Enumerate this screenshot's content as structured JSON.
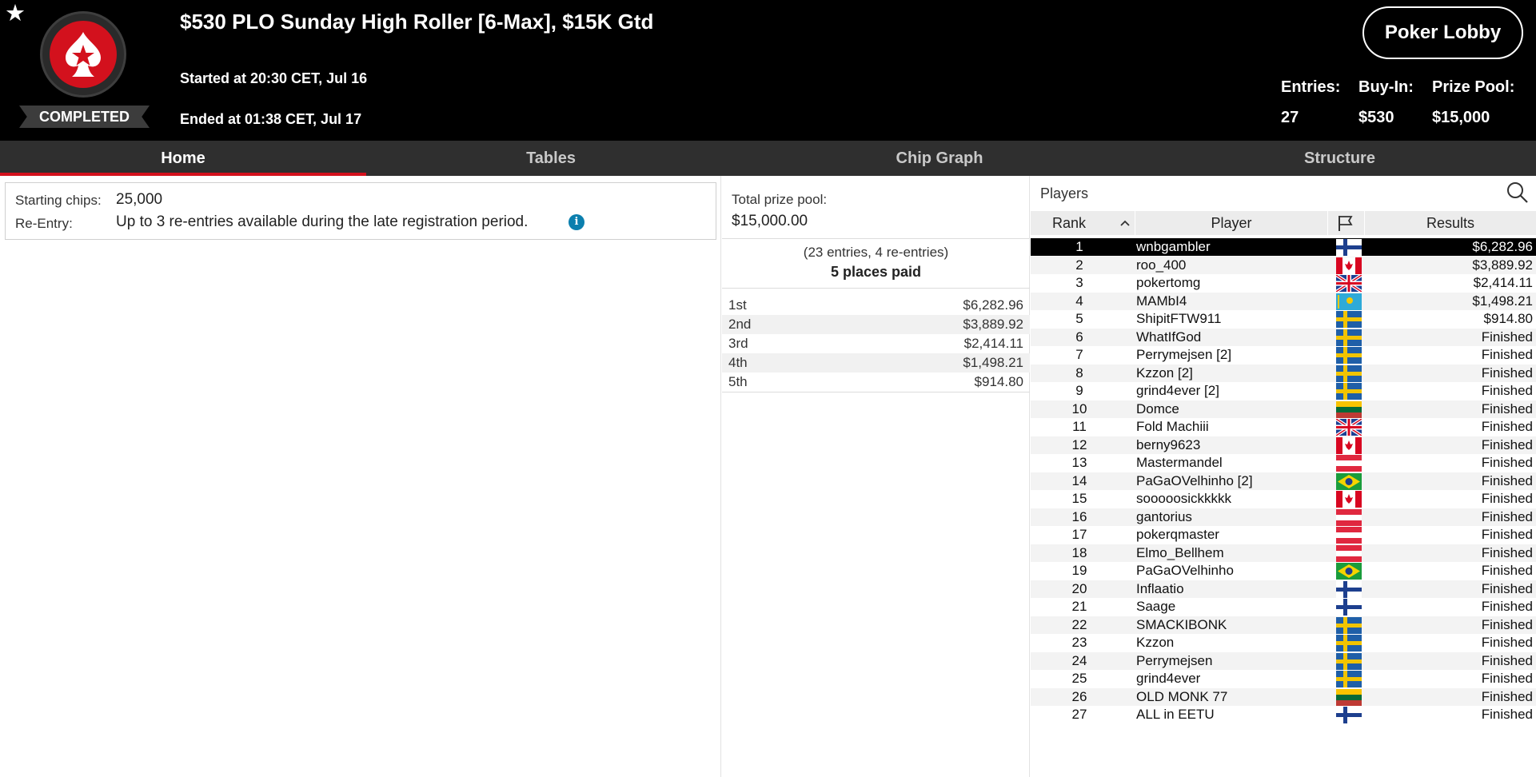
{
  "header": {
    "title": "$530 PLO Sunday High Roller [6-Max], $15K Gtd",
    "started": "Started at 20:30 CET, Jul 16",
    "ended": "Ended at 01:38 CET, Jul 17",
    "status": "COMPLETED",
    "lobby_button": "Poker Lobby",
    "stats": {
      "entries_label": "Entries:",
      "entries_value": "27",
      "buyin_label": "Buy-In:",
      "buyin_value": "$530",
      "prizepool_label": "Prize Pool:",
      "prizepool_value": "$15,000"
    }
  },
  "tabs": [
    {
      "label": "Home",
      "active": true
    },
    {
      "label": "Tables",
      "active": false
    },
    {
      "label": "Chip Graph",
      "active": false
    },
    {
      "label": "Structure",
      "active": false
    }
  ],
  "home": {
    "starting_chips_label": "Starting chips:",
    "starting_chips_value": "25,000",
    "reentry_label": "Re-Entry:",
    "reentry_value": "Up to 3 re-entries available during the late registration period."
  },
  "prize": {
    "total_label": "Total prize pool:",
    "total_value": "$15,000.00",
    "entries_note": "(23 entries, 4 re-entries)",
    "places_paid": "5 places paid",
    "payouts": [
      {
        "place": "1st",
        "amount": "$6,282.96"
      },
      {
        "place": "2nd",
        "amount": "$3,889.92"
      },
      {
        "place": "3rd",
        "amount": "$2,414.11"
      },
      {
        "place": "4th",
        "amount": "$1,498.21"
      },
      {
        "place": "5th",
        "amount": "$914.80"
      }
    ]
  },
  "players": {
    "heading": "Players",
    "columns": {
      "rank": "Rank",
      "player": "Player",
      "results": "Results"
    },
    "colors": {
      "selected_row": "#000000",
      "accent": "#d3111d"
    },
    "rows": [
      {
        "rank": "1",
        "name": "wnbgambler",
        "flag": "finland",
        "result": "$6,282.96"
      },
      {
        "rank": "2",
        "name": "roo_400",
        "flag": "canada",
        "result": "$3,889.92"
      },
      {
        "rank": "3",
        "name": "pokertomg",
        "flag": "uk",
        "result": "$2,414.11"
      },
      {
        "rank": "4",
        "name": "MAMbI4",
        "flag": "kazakhstan",
        "result": "$1,498.21"
      },
      {
        "rank": "5",
        "name": "ShipitFTW911",
        "flag": "sweden",
        "result": "$914.80"
      },
      {
        "rank": "6",
        "name": "WhatIfGod",
        "flag": "sweden",
        "result": "Finished"
      },
      {
        "rank": "7",
        "name": "Perrymejsen [2]",
        "flag": "sweden",
        "result": "Finished"
      },
      {
        "rank": "8",
        "name": "Kzzon [2]",
        "flag": "sweden",
        "result": "Finished"
      },
      {
        "rank": "9",
        "name": "grind4ever [2]",
        "flag": "sweden",
        "result": "Finished"
      },
      {
        "rank": "10",
        "name": "Domce",
        "flag": "lithuania",
        "result": "Finished"
      },
      {
        "rank": "11",
        "name": "Fold Machiii",
        "flag": "uk",
        "result": "Finished"
      },
      {
        "rank": "12",
        "name": "berny9623",
        "flag": "canada",
        "result": "Finished"
      },
      {
        "rank": "13",
        "name": "Mastermandel",
        "flag": "austria",
        "result": "Finished"
      },
      {
        "rank": "14",
        "name": "PaGaOVelhinho [2]",
        "flag": "brazil",
        "result": "Finished"
      },
      {
        "rank": "15",
        "name": "sooooosickkkkk",
        "flag": "canada",
        "result": "Finished"
      },
      {
        "rank": "16",
        "name": "gantorius",
        "flag": "austria",
        "result": "Finished"
      },
      {
        "rank": "17",
        "name": "pokerqmaster",
        "flag": "austria",
        "result": "Finished"
      },
      {
        "rank": "18",
        "name": "Elmo_Bellhem",
        "flag": "austria",
        "result": "Finished"
      },
      {
        "rank": "19",
        "name": "PaGaOVelhinho",
        "flag": "brazil",
        "result": "Finished"
      },
      {
        "rank": "20",
        "name": "Inflaatio",
        "flag": "finland",
        "result": "Finished"
      },
      {
        "rank": "21",
        "name": "Saage",
        "flag": "finland",
        "result": "Finished"
      },
      {
        "rank": "22",
        "name": "SMACKIBONK",
        "flag": "sweden",
        "result": "Finished"
      },
      {
        "rank": "23",
        "name": "Kzzon",
        "flag": "sweden",
        "result": "Finished"
      },
      {
        "rank": "24",
        "name": "Perrymejsen",
        "flag": "sweden",
        "result": "Finished"
      },
      {
        "rank": "25",
        "name": "grind4ever",
        "flag": "sweden",
        "result": "Finished"
      },
      {
        "rank": "26",
        "name": "OLD MONK 77",
        "flag": "lithuania",
        "result": "Finished"
      },
      {
        "rank": "27",
        "name": "ALL in EETU",
        "flag": "finland",
        "result": "Finished"
      }
    ]
  }
}
